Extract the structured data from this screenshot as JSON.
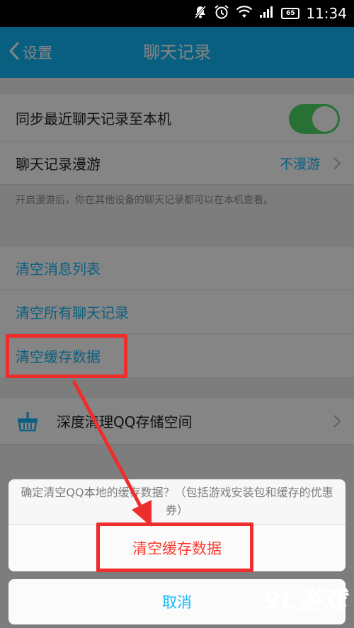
{
  "status_bar": {
    "icons": [
      "no-notification-icon",
      "alarm-icon",
      "wifi-icon",
      "signal-icon"
    ],
    "battery": "65",
    "time": "11:34"
  },
  "nav": {
    "back_label": "设置",
    "title": "聊天记录"
  },
  "settings": {
    "sync_label": "同步最近聊天记录至本机",
    "sync_enabled": true,
    "roaming_label": "聊天记录漫游",
    "roaming_value": "不漫游",
    "roaming_hint": "开启漫游后，你在其他设备的聊天记录都可以在本机查看。",
    "clear_message_list": "清空消息列表",
    "clear_all_records": "清空所有聊天记录",
    "clear_cache": "清空缓存数据",
    "deep_clean": "深度清理QQ存储空间"
  },
  "action_sheet": {
    "message": "确定清空QQ本地的缓存数据？（包括游戏安装包和缓存的优惠券）",
    "confirm_label": "清空缓存数据",
    "cancel_label": "取消"
  },
  "watermark": {
    "brand": "9L游戏",
    "domain": "91danji.com"
  },
  "colors": {
    "accent": "#12b7f5",
    "toggle_on": "#4cd964",
    "danger": "#ff3b30",
    "annotation": "#ee2d2d"
  }
}
